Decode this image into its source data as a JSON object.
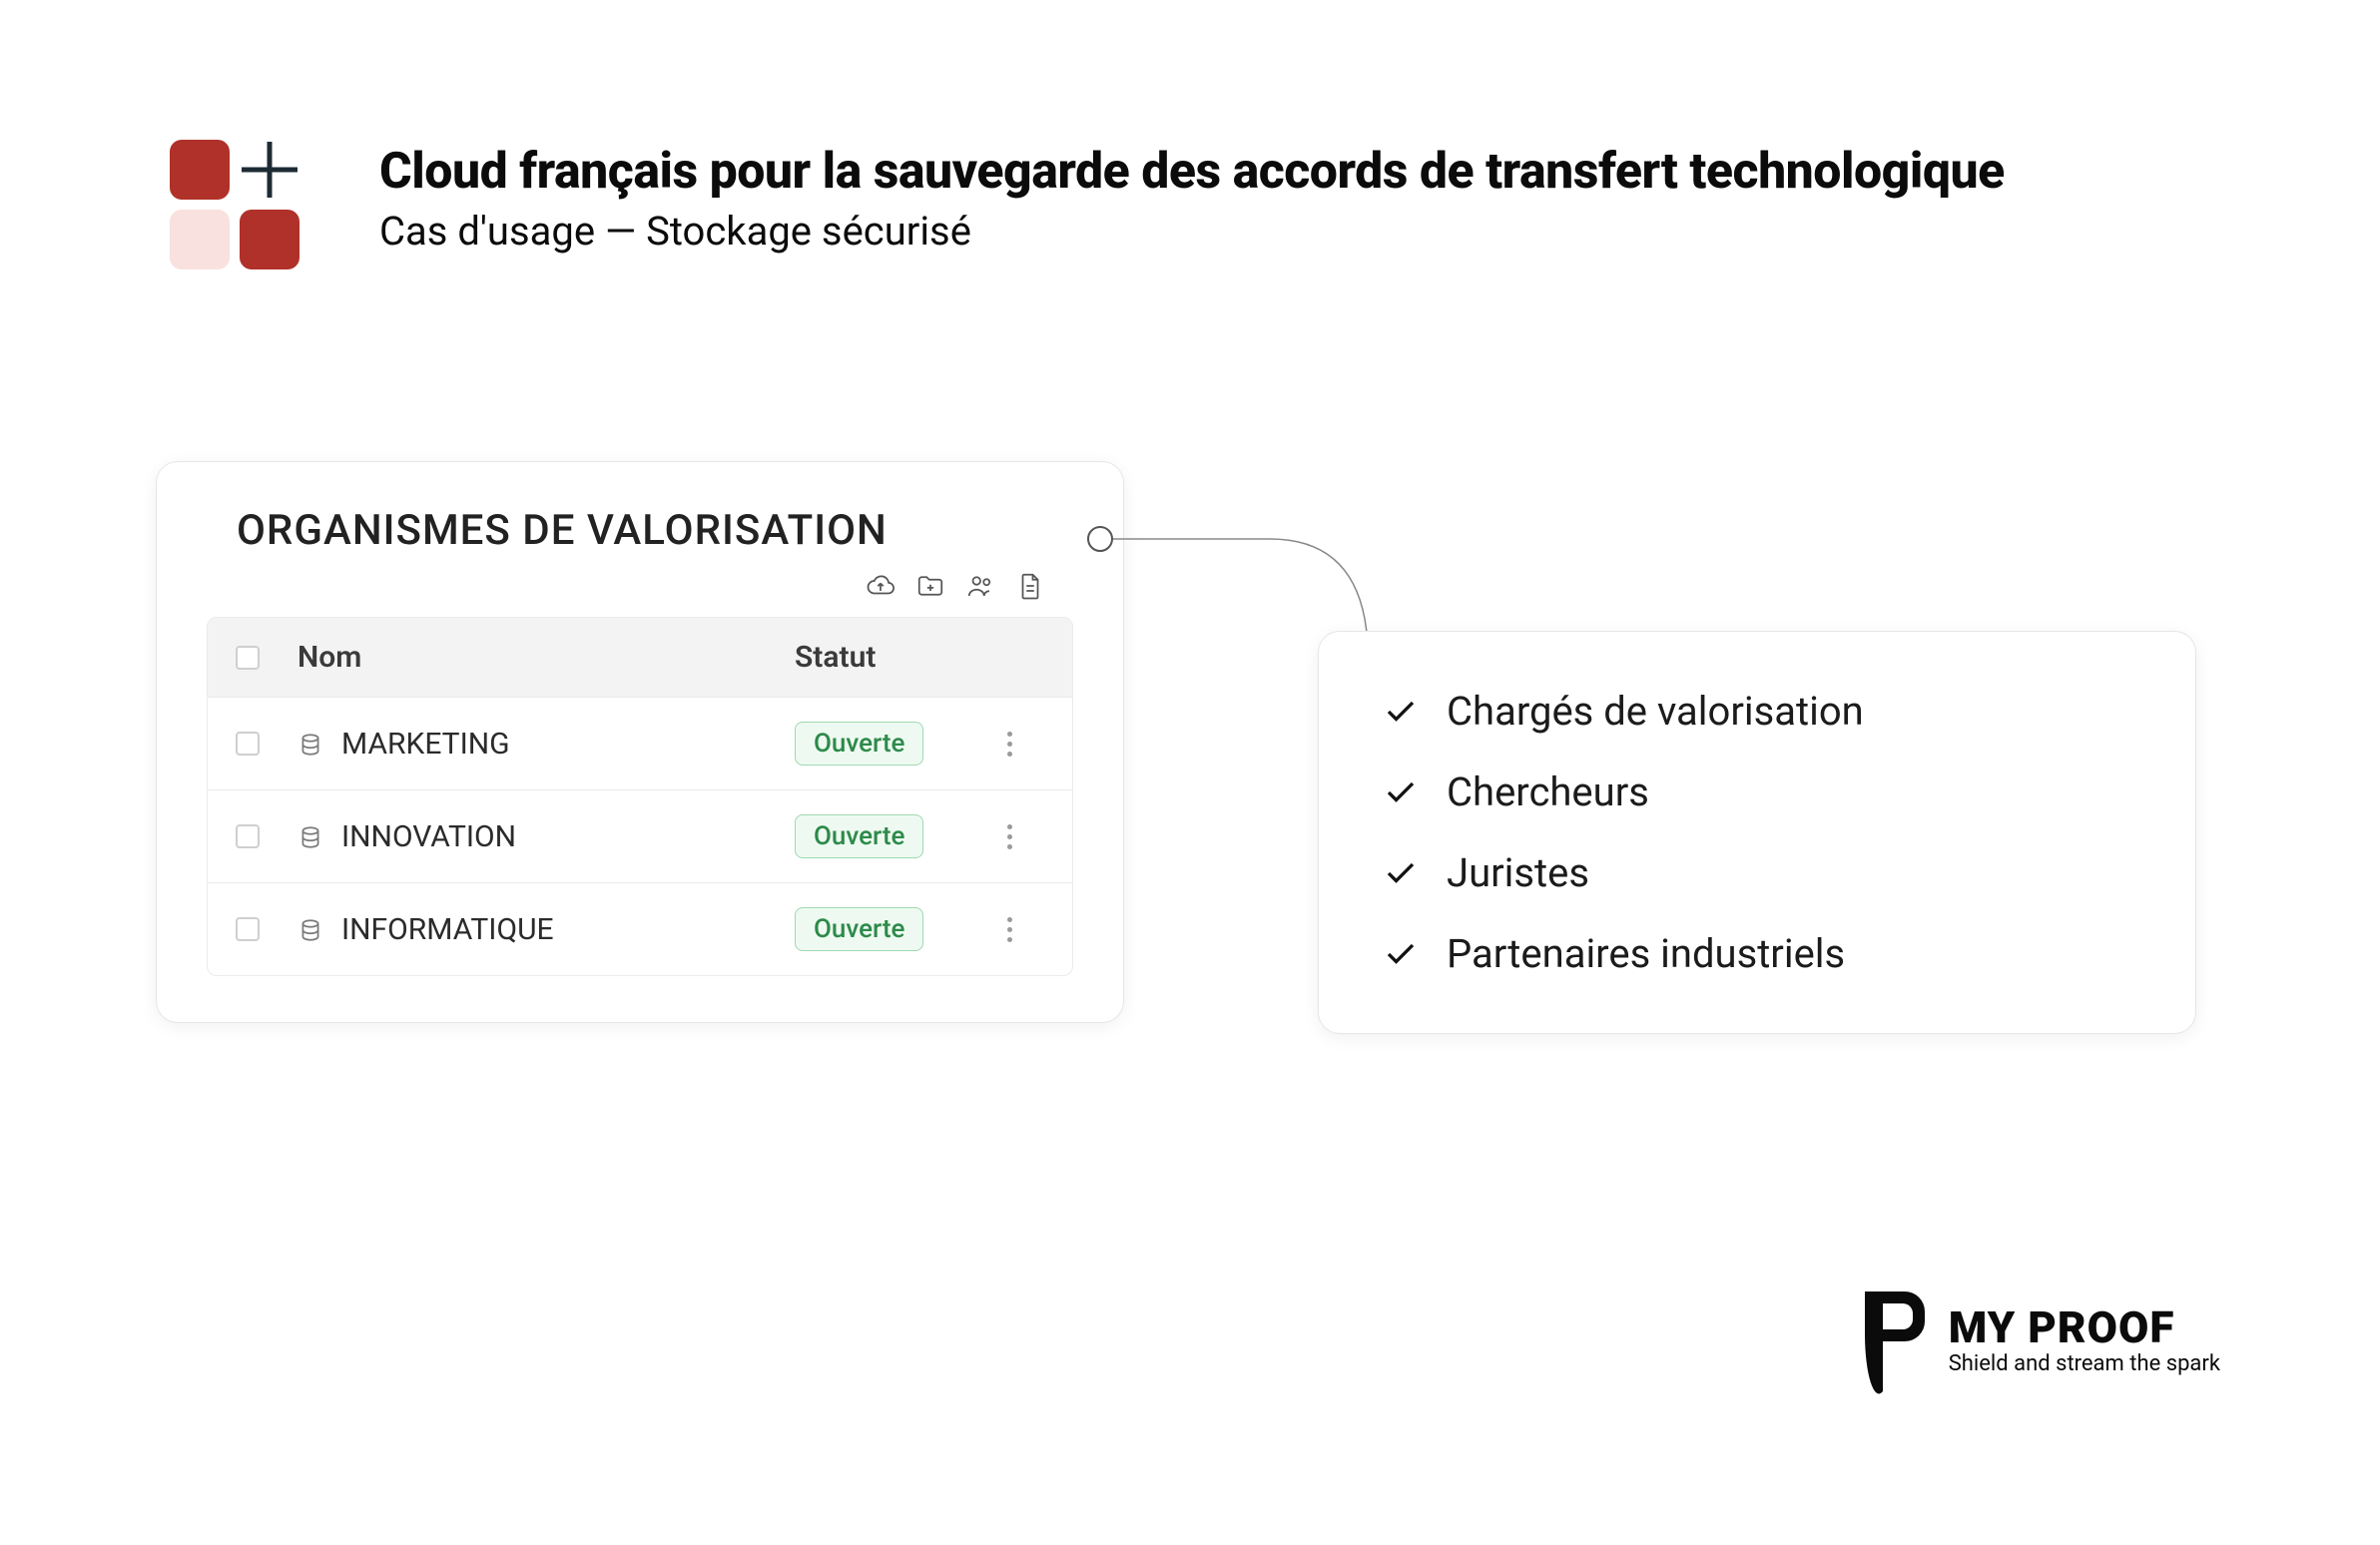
{
  "header": {
    "title": "Cloud français pour la sauvegarde des accords de transfert technologique",
    "subtitle": "Cas d'usage — Stockage sécurisé"
  },
  "panel": {
    "title": "ORGANISMES DE VALORISATION",
    "columns": {
      "name": "Nom",
      "status": "Statut"
    },
    "toolbar_icons": [
      "cloud-upload-icon",
      "folder-plus-icon",
      "users-icon",
      "file-icon"
    ],
    "rows": [
      {
        "name": "MARKETING",
        "status": "Ouverte"
      },
      {
        "name": "INNOVATION",
        "status": "Ouverte"
      },
      {
        "name": "INFORMATIQUE",
        "status": "Ouverte"
      }
    ]
  },
  "side": {
    "items": [
      "Chargés de valorisation",
      "Chercheurs",
      "Juristes",
      "Partenaires industriels"
    ]
  },
  "footer": {
    "brand": "MY PROOF",
    "tagline": "Shield and stream the spark"
  }
}
